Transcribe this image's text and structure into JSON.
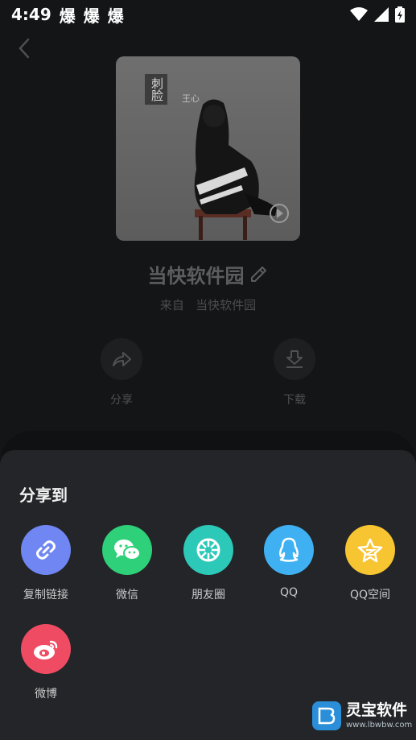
{
  "status_bar": {
    "time": "4:49",
    "notifications": [
      "爆",
      "爆",
      "爆"
    ]
  },
  "song": {
    "title": "当快软件园",
    "source_prefix": "来自",
    "source_name": "当快软件园",
    "cover_text": "刺脸",
    "cover_small": "王心"
  },
  "actions": {
    "share_label": "分享",
    "download_label": "下载"
  },
  "share_sheet": {
    "title": "分享到",
    "items": [
      {
        "label": "复制链接",
        "color": "#6f86f3",
        "icon": "link-icon"
      },
      {
        "label": "微信",
        "color": "#2fd07a",
        "icon": "wechat-icon"
      },
      {
        "label": "朋友圈",
        "color": "#2dc9b8",
        "icon": "moments-icon"
      },
      {
        "label": "QQ",
        "color": "#3fb1f2",
        "icon": "qq-icon"
      },
      {
        "label": "QQ空间",
        "color": "#f7c532",
        "icon": "qzone-icon"
      },
      {
        "label": "微博",
        "color": "#ef4b63",
        "icon": "weibo-icon"
      }
    ]
  },
  "watermark": {
    "name": "灵宝软件",
    "url": "www.lbwbw.com"
  }
}
